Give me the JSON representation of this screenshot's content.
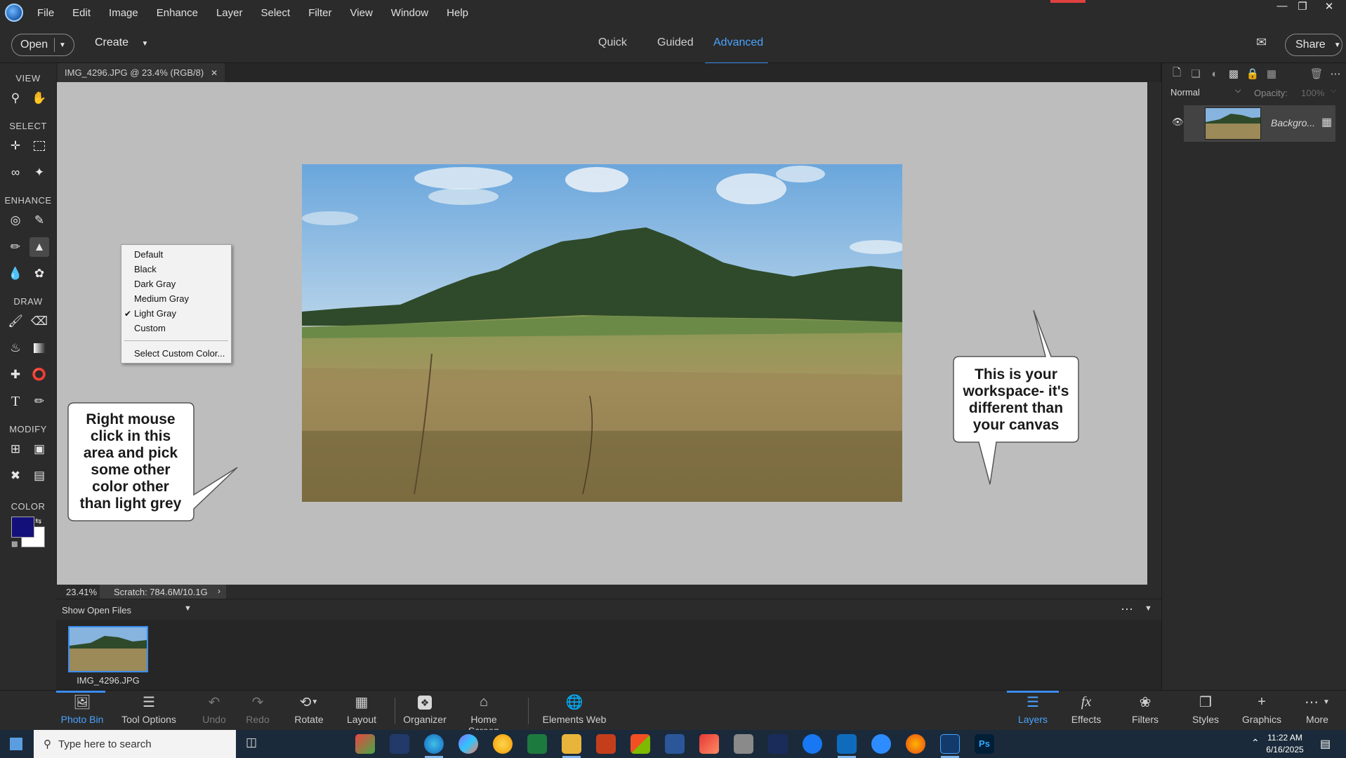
{
  "menubar": {
    "items": [
      "File",
      "Edit",
      "Image",
      "Enhance",
      "Layer",
      "Select",
      "Filter",
      "View",
      "Window",
      "Help"
    ]
  },
  "modebar": {
    "open_label": "Open",
    "create_label": "Create",
    "modes": [
      "Quick",
      "Guided",
      "Advanced"
    ],
    "active_mode": "Advanced",
    "share_label": "Share"
  },
  "toolbox": {
    "sections": [
      "VIEW",
      "SELECT",
      "ENHANCE",
      "DRAW",
      "MODIFY",
      "COLOR"
    ],
    "foreground_color": "#14107a",
    "background_color": "#ffffff"
  },
  "document": {
    "tab_title": "IMG_4296.JPG @ 23.4% (RGB/8)",
    "zoom": "23.41%",
    "scratch": "Scratch: 784.6M/10.1G"
  },
  "context_menu": {
    "items": [
      "Default",
      "Black",
      "Dark Gray",
      "Medium Gray",
      "Light Gray",
      "Custom"
    ],
    "checked": "Light Gray",
    "extra": "Select Custom Color..."
  },
  "callouts": {
    "left": [
      "Right mouse",
      "click in this",
      "area and pick",
      "some other",
      "color other",
      "than light grey"
    ],
    "right": [
      "This is your",
      "workspace- it's",
      "different than",
      "your canvas"
    ]
  },
  "photo_bin": {
    "dropdown_label": "Show Open Files",
    "thumb_label": "IMG_4296.JPG"
  },
  "layers_panel": {
    "blend_mode": "Normal",
    "opacity_label": "Opacity:",
    "opacity_value": "100%",
    "layer_name": "Backgro..."
  },
  "bottom_bar": {
    "left": [
      "Photo Bin",
      "Tool Options",
      "Undo",
      "Redo",
      "Rotate",
      "Layout",
      "Organizer",
      "Home Screen",
      "Elements Web"
    ],
    "right": [
      "Layers",
      "Effects",
      "Filters",
      "Styles",
      "Graphics",
      "More"
    ]
  },
  "windows_taskbar": {
    "search_placeholder": "Type here to search",
    "time": "11:22 AM",
    "date": "6/16/2025"
  }
}
